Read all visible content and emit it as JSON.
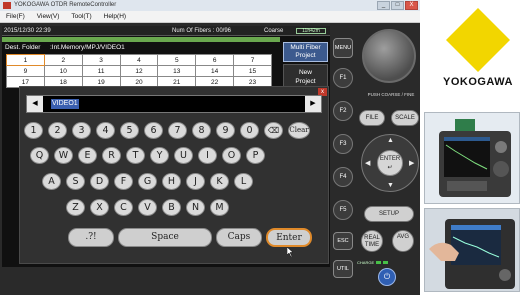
{
  "window": {
    "title": "YOKOGAWA OTDR RemoteController",
    "controls": [
      "_",
      "□",
      "X"
    ]
  },
  "menubar": [
    "File(F)",
    "View(V)",
    "Tool(T)",
    "Help(H)"
  ],
  "status": {
    "datetime": "2015/12/30 22:39",
    "fibers": "Num Of Fibers : 00/96",
    "mode": "Coarse",
    "battery": "11h42m"
  },
  "dest": {
    "label": "Dest. Folder",
    "value": ":Int.Memory/MPJ/VIDEO1"
  },
  "grid": {
    "rows": [
      [
        "1",
        "2",
        "3",
        "4",
        "5",
        "6",
        "7",
        "8"
      ],
      [
        "9",
        "10",
        "11",
        "12",
        "13",
        "14",
        "15",
        "16"
      ],
      [
        "17",
        "18",
        "19",
        "20",
        "21",
        "22",
        "23",
        "24"
      ]
    ],
    "selected": "1"
  },
  "side_buttons": {
    "multi_fiber": [
      "Multi Fiber",
      "Project"
    ],
    "new_project": [
      "New",
      "Project"
    ]
  },
  "keyboard": {
    "close": "x",
    "left_arrow": "◀",
    "right_arrow": "▶",
    "input_value": "VIDEO1",
    "number_row": [
      "1",
      "2",
      "3",
      "4",
      "5",
      "6",
      "7",
      "8",
      "9",
      "0"
    ],
    "backspace": "⌫",
    "clear": "Clear",
    "row_q": [
      "Q",
      "W",
      "E",
      "R",
      "T",
      "Y",
      "U",
      "I",
      "O",
      "P"
    ],
    "row_a": [
      "A",
      "S",
      "D",
      "F",
      "G",
      "H",
      "J",
      "K",
      "L"
    ],
    "row_z": [
      "Z",
      "X",
      "C",
      "V",
      "B",
      "N",
      "M"
    ],
    "symbols": ".?!",
    "space": "Space",
    "caps": "Caps",
    "enter": "Enter"
  },
  "fkeys": {
    "menu": "MENU",
    "f": [
      "F1",
      "F2",
      "F3",
      "F4",
      "F5"
    ],
    "esc": "ESC",
    "util": "UTIL"
  },
  "panel": {
    "push_label": "PUSH COARSE / FINE",
    "file": "FILE",
    "scale": "SCALE",
    "enter": "ENTER",
    "enter_glyph": "↵",
    "setup": "SETUP",
    "realtime": [
      "REAL",
      "TIME"
    ],
    "avg": "AVG",
    "charge": "CHARGE",
    "power": "⏻"
  },
  "brand": {
    "name": "YOKOGAWA",
    "logo_color": "#f2d600"
  }
}
